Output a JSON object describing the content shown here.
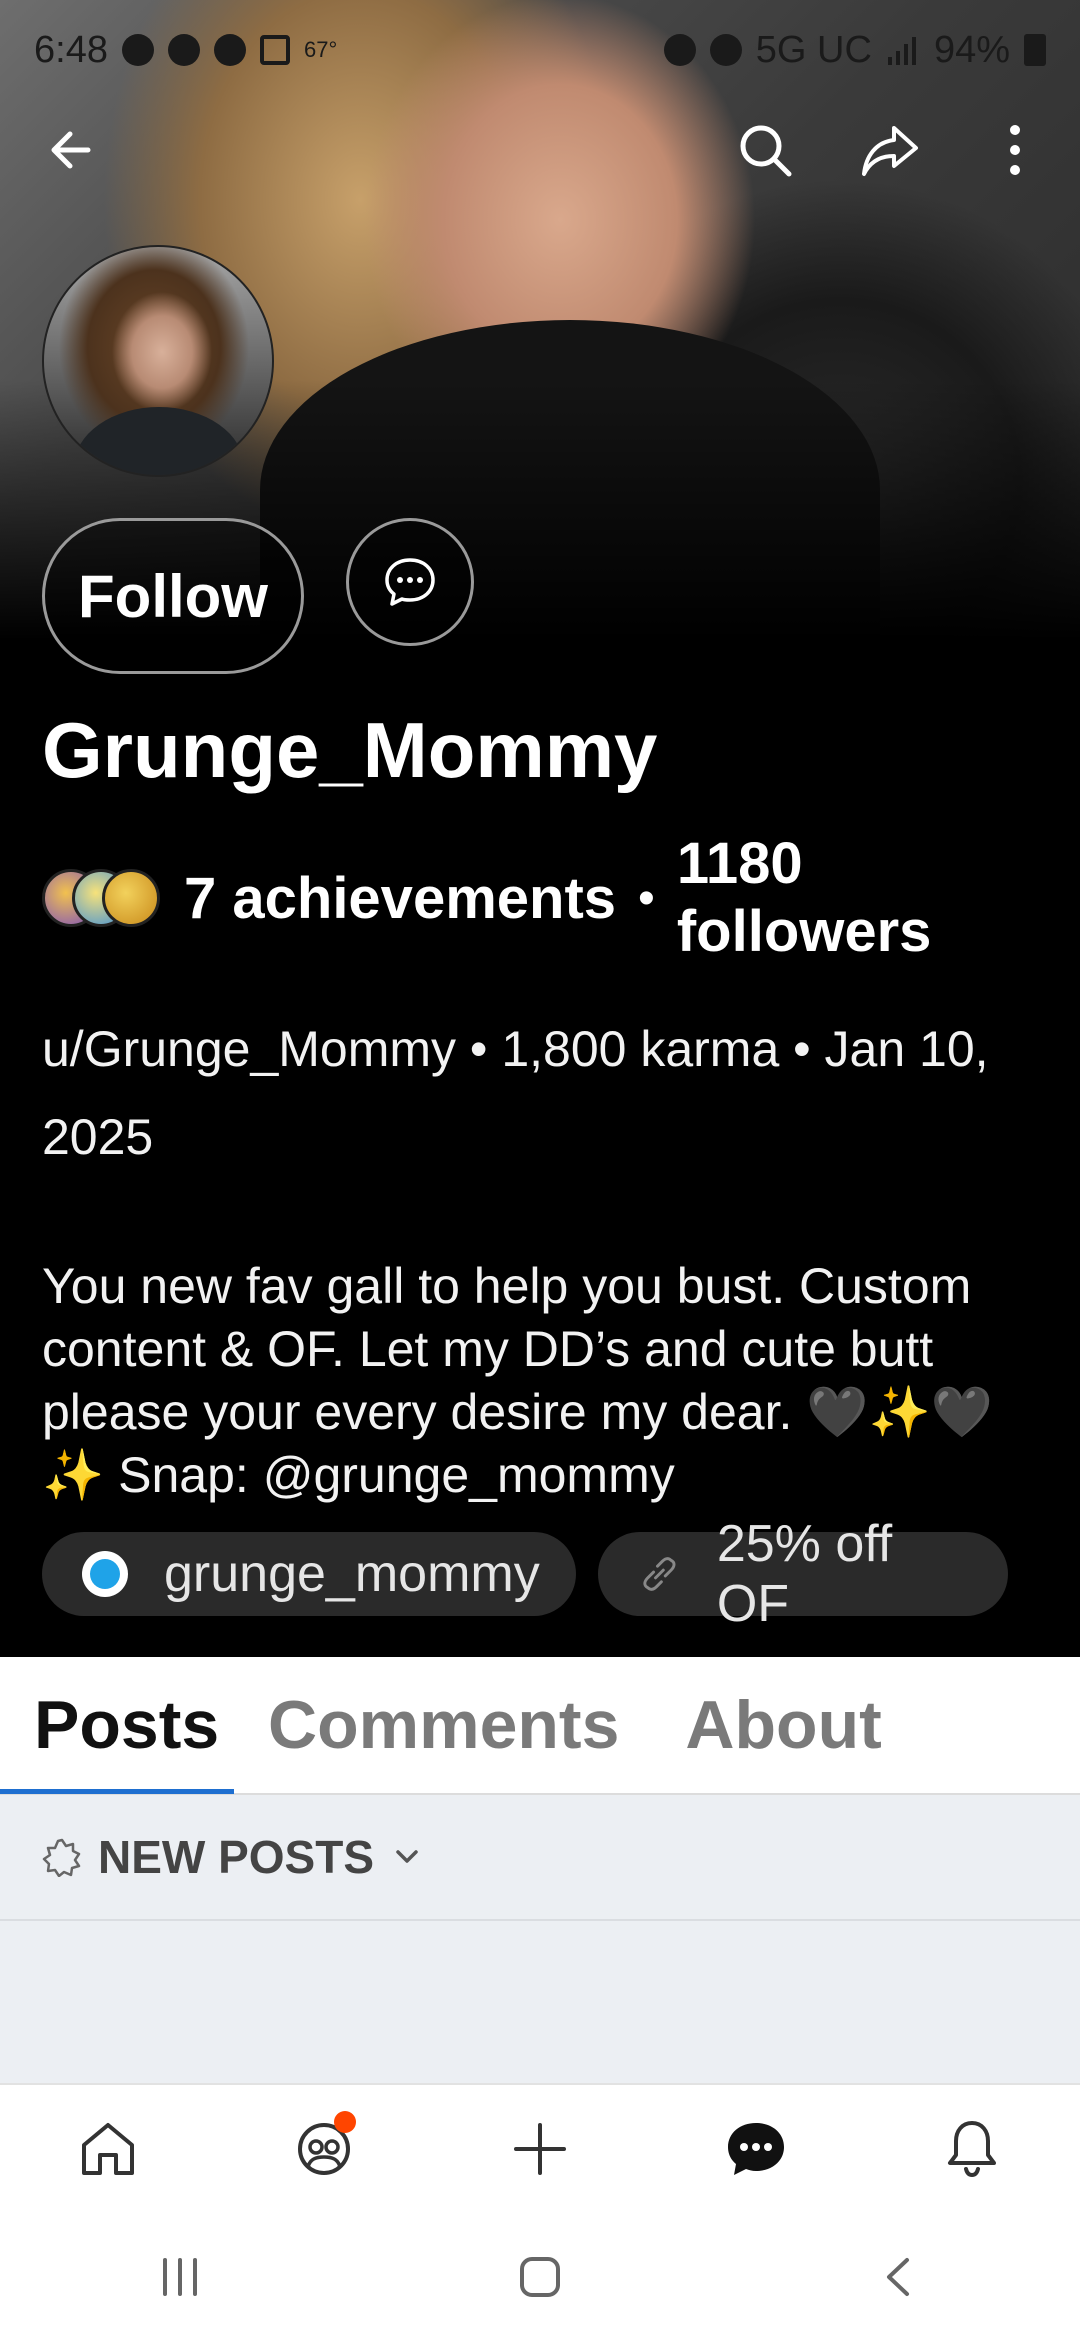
{
  "status_bar": {
    "time": "6:48",
    "temperature": "67°",
    "network": "5G UC",
    "battery": "94%"
  },
  "profile": {
    "follow_label": "Follow",
    "username": "Grunge_Mommy",
    "achievements": "7 achievements",
    "separator": "•",
    "followers": "1180 followers",
    "meta": "u/Grunge_Mommy • 1,800 karma • Jan 10, 2025",
    "bio": "You new fav gall to help you bust. Custom content & OF. Let my DD’s and cute butt please your every desire my dear. 🖤✨🖤✨ Snap: @grunge_mommy",
    "links": [
      {
        "label": "grunge_mommy",
        "icon": "onlyfans-icon"
      },
      {
        "label": "25% off OF",
        "icon": "link-icon"
      }
    ]
  },
  "tabs": [
    {
      "label": "Posts",
      "active": true
    },
    {
      "label": "Comments",
      "active": false
    },
    {
      "label": "About",
      "active": false
    }
  ],
  "sort": {
    "label": "NEW POSTS"
  },
  "bottom_nav": [
    "home-icon",
    "communities-icon",
    "create-icon",
    "chat-icon",
    "notifications-icon"
  ],
  "colors": {
    "accent": "#1e6fd0",
    "notification": "#ff4500",
    "background": "#000000"
  }
}
